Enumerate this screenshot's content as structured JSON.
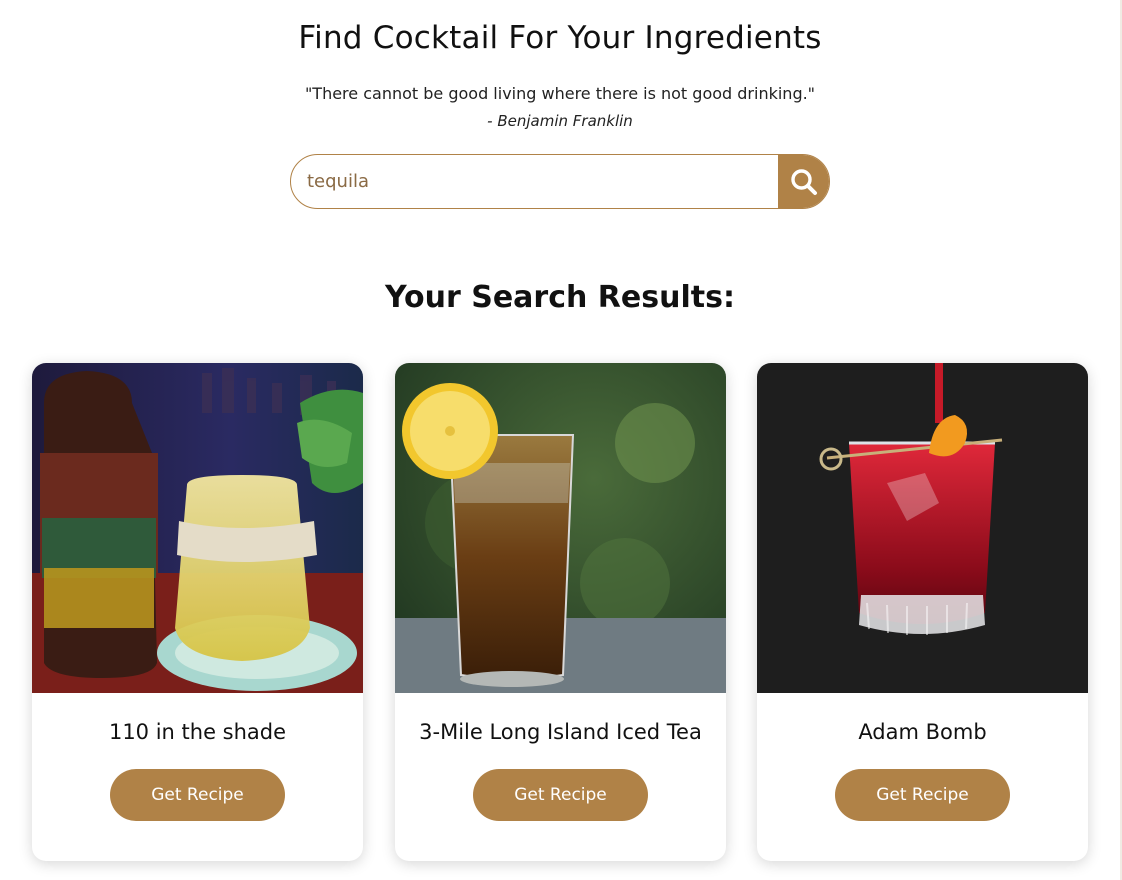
{
  "header": {
    "title": "Find Cocktail For Your Ingredients",
    "quote": "\"There cannot be good living where there is not good drinking.\"",
    "author": "- Benjamin Franklin"
  },
  "search": {
    "value": "tequila",
    "button_icon": "search-icon"
  },
  "results": {
    "title": "Your Search Results:",
    "cards": [
      {
        "name": "110 in the shade",
        "button_label": "Get Recipe",
        "image": "cocktail-photo-yellow-drink"
      },
      {
        "name": "3-Mile Long Island Iced Tea",
        "button_label": "Get Recipe",
        "image": "cocktail-photo-iced-tea"
      },
      {
        "name": "Adam Bomb",
        "button_label": "Get Recipe",
        "image": "cocktail-photo-red-drink"
      }
    ]
  },
  "colors": {
    "accent": "#b08247",
    "card_background": "#ffffff",
    "text": "#111111"
  }
}
